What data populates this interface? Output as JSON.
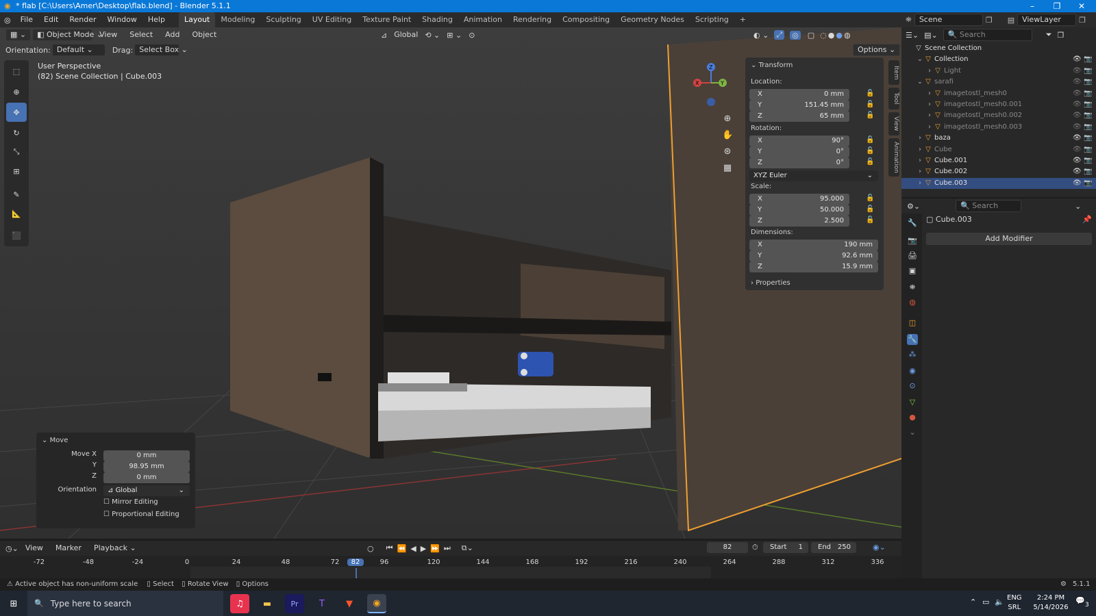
{
  "window": {
    "title": "* flab [C:\\Users\\Amer\\Desktop\\flab.blend] - Blender 5.1.1",
    "minimize": "–",
    "maximize": "❐",
    "close": "✕"
  },
  "menu": [
    "File",
    "Edit",
    "Render",
    "Window",
    "Help"
  ],
  "workspaces": [
    "Layout",
    "Modeling",
    "Sculpting",
    "UV Editing",
    "Texture Paint",
    "Shading",
    "Animation",
    "Rendering",
    "Compositing",
    "Geometry Nodes",
    "Scripting"
  ],
  "workspace_add": "+",
  "topright": {
    "scene": "Scene",
    "viewlayer": "ViewLayer"
  },
  "vpheader": {
    "mode": "Object Mode",
    "items": [
      "View",
      "Select",
      "Add",
      "Object"
    ],
    "transform": "Global",
    "options": "Options"
  },
  "toolsettings": {
    "orientation_label": "Orientation:",
    "orientation": "Default",
    "drag_label": "Drag:",
    "drag": "Select Box"
  },
  "overlay": {
    "line1": "User Perspective",
    "line2": "(82) Scene Collection | Cube.003"
  },
  "gizmo": {
    "x": "X",
    "y": "Y",
    "z": "Z"
  },
  "npanel": {
    "header": "Transform",
    "location_label": "Location:",
    "location": [
      {
        "axis": "X",
        "value": "0 mm"
      },
      {
        "axis": "Y",
        "value": "151.45 mm"
      },
      {
        "axis": "Z",
        "value": "65 mm"
      }
    ],
    "rotation_label": "Rotation:",
    "rotation": [
      {
        "axis": "X",
        "value": "90°"
      },
      {
        "axis": "Y",
        "value": "0°"
      },
      {
        "axis": "Z",
        "value": "0°"
      }
    ],
    "rotation_mode": "XYZ Euler",
    "scale_label": "Scale:",
    "scale": [
      {
        "axis": "X",
        "value": "95.000"
      },
      {
        "axis": "Y",
        "value": "50.000"
      },
      {
        "axis": "Z",
        "value": "2.500"
      }
    ],
    "dimensions_label": "Dimensions:",
    "dimensions": [
      {
        "axis": "X",
        "value": "190 mm"
      },
      {
        "axis": "Y",
        "value": "92.6 mm"
      },
      {
        "axis": "Z",
        "value": "15.9 mm"
      }
    ],
    "properties": "Properties",
    "tabs": [
      "Item",
      "Tool",
      "View",
      "Animation"
    ]
  },
  "lastop": {
    "title": "Move",
    "rows": [
      {
        "label": "Move X",
        "value": "0 mm"
      },
      {
        "label": "Y",
        "value": "98.95 mm"
      },
      {
        "label": "Z",
        "value": "0 mm"
      }
    ],
    "orientation_label": "Orientation",
    "orientation": "Global",
    "mirror": "Mirror Editing",
    "proportional": "Proportional Editing"
  },
  "outliner": {
    "search": "Search",
    "rows": [
      {
        "name": "Scene Collection",
        "indent": 0,
        "arrow": "",
        "sel": false,
        "dim": false
      },
      {
        "name": "Collection",
        "indent": 1,
        "arrow": "⌄",
        "sel": false,
        "dim": false
      },
      {
        "name": "Light",
        "indent": 2,
        "arrow": "›",
        "sel": false,
        "dim": true
      },
      {
        "name": "sarafi",
        "indent": 1,
        "arrow": "⌄",
        "sel": false,
        "dim": true
      },
      {
        "name": "imagetostl_mesh0",
        "indent": 2,
        "arrow": "›",
        "sel": false,
        "dim": true
      },
      {
        "name": "imagetostl_mesh0.001",
        "indent": 2,
        "arrow": "›",
        "sel": false,
        "dim": true
      },
      {
        "name": "imagetostl_mesh0.002",
        "indent": 2,
        "arrow": "›",
        "sel": false,
        "dim": true
      },
      {
        "name": "imagetostl_mesh0.003",
        "indent": 2,
        "arrow": "›",
        "sel": false,
        "dim": true
      },
      {
        "name": "baza",
        "indent": 1,
        "arrow": "›",
        "sel": false,
        "dim": false
      },
      {
        "name": "Cube",
        "indent": 1,
        "arrow": "›",
        "sel": false,
        "dim": true
      },
      {
        "name": "Cube.001",
        "indent": 1,
        "arrow": "›",
        "sel": false,
        "dim": false
      },
      {
        "name": "Cube.002",
        "indent": 1,
        "arrow": "›",
        "sel": false,
        "dim": false
      },
      {
        "name": "Cube.003",
        "indent": 1,
        "arrow": "›",
        "sel": true,
        "dim": false
      }
    ]
  },
  "props": {
    "search": "Search",
    "object": "Cube.003",
    "add_modifier": "Add Modifier"
  },
  "timeline": {
    "items": [
      "View",
      "Marker",
      "Playback"
    ],
    "current_frame": "82",
    "start_label": "Start",
    "start": "1",
    "end_label": "End",
    "end": "250",
    "ticks": [
      "-72",
      "-48",
      "-24",
      "0",
      "24",
      "48",
      "72",
      "82",
      "96",
      "120",
      "144",
      "168",
      "192",
      "216",
      "240",
      "264",
      "288",
      "312",
      "336"
    ]
  },
  "status": {
    "warning": "Active object has non-uniform scale",
    "select": "Select",
    "rotate": "Rotate View",
    "options": "Options",
    "version": "5.1.1"
  },
  "taskbar": {
    "search": "Type here to search",
    "lang1": "ENG",
    "lang2": "SRL",
    "time": "2:24 PM",
    "date": "5/14/2026",
    "notif": "3"
  }
}
